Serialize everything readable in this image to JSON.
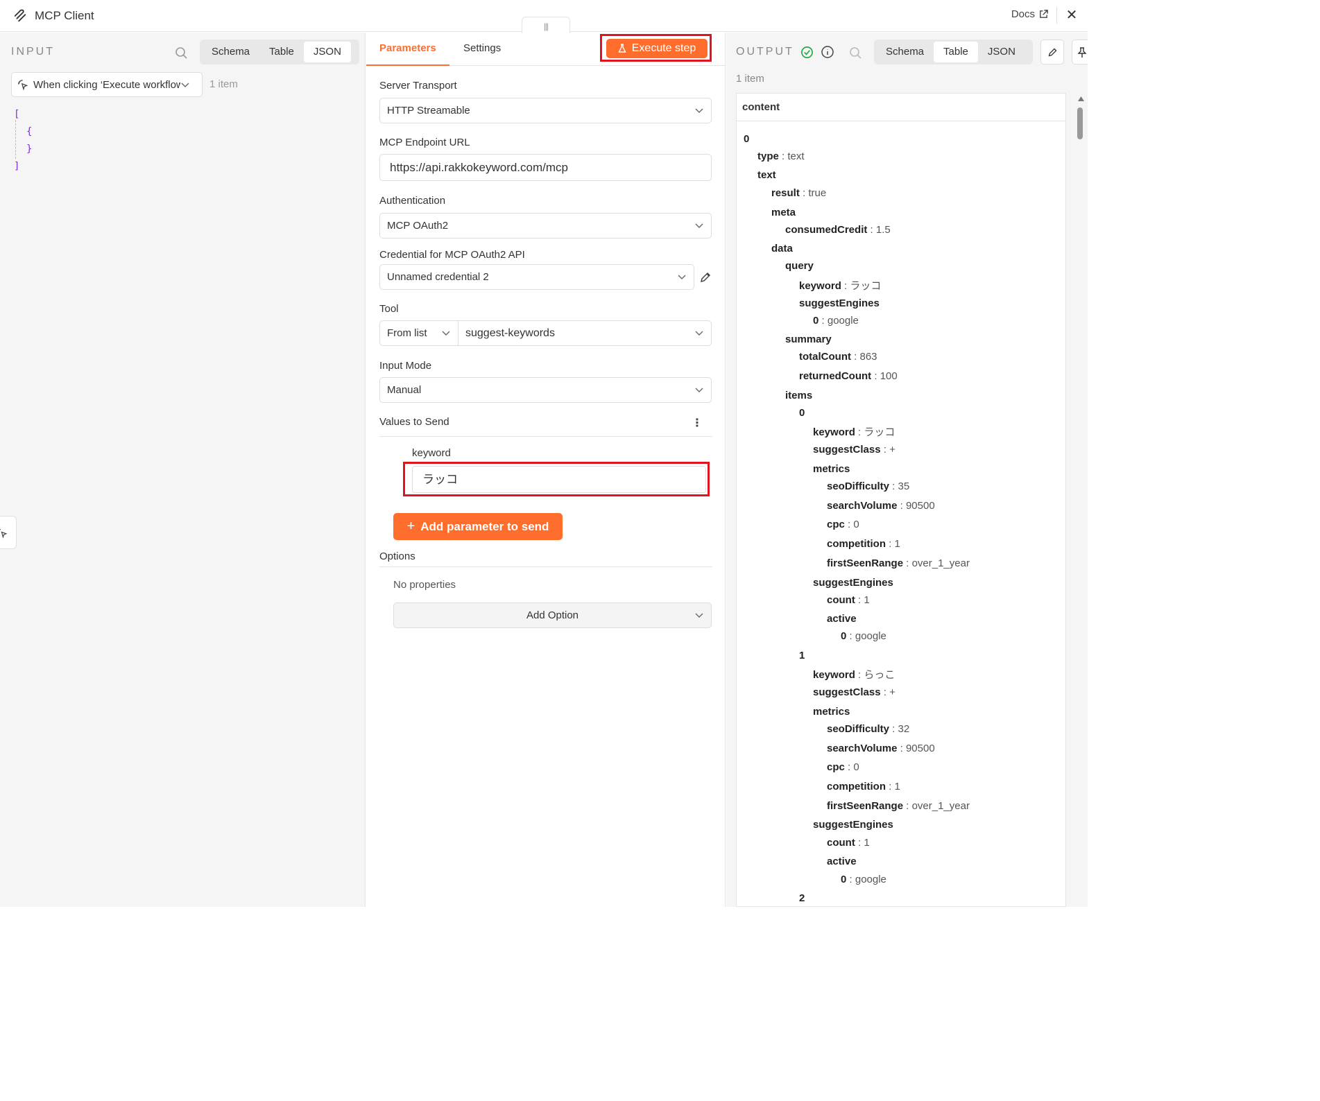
{
  "window": {
    "title": "MCP Client",
    "docs_label": "Docs",
    "close_glyph": "✕"
  },
  "drag_handle_glyph": "|||",
  "input": {
    "label": "INPUT",
    "views": [
      "Schema",
      "Table",
      "JSON"
    ],
    "active_view": "JSON",
    "trigger": "When clicking ‘Execute workflow’",
    "item_count": "1 item",
    "json_lines": [
      "[",
      "{",
      "}",
      "]"
    ]
  },
  "params": {
    "tabs": [
      "Parameters",
      "Settings"
    ],
    "active_tab": "Parameters",
    "execute_label": "Execute step",
    "server_transport": {
      "label": "Server Transport",
      "value": "HTTP Streamable"
    },
    "endpoint": {
      "label": "MCP Endpoint URL",
      "value": "https://api.rakkokeyword.com/mcp"
    },
    "authentication": {
      "label": "Authentication",
      "value": "MCP OAuth2"
    },
    "credential": {
      "label": "Credential for MCP OAuth2 API",
      "value": "Unnamed credential 2"
    },
    "tool": {
      "label": "Tool",
      "mode": "From list",
      "value": "suggest-keywords"
    },
    "input_mode": {
      "label": "Input Mode",
      "value": "Manual"
    },
    "values_to_send": {
      "label": "Values to Send",
      "kebab": "⋮",
      "param_name": "keyword",
      "param_value": "ラッコ"
    },
    "add_param_label": "Add parameter to send",
    "options": {
      "label": "Options",
      "empty": "No properties",
      "add_label": "Add Option"
    }
  },
  "output": {
    "label": "OUTPUT",
    "views": [
      "Schema",
      "Table",
      "JSON"
    ],
    "active_view": "Table",
    "item_count": "1 item",
    "column": "content",
    "rows": [
      {
        "k": "0",
        "lvl": 0
      },
      {
        "k": "type",
        "v": "text",
        "lvl": 1
      },
      {
        "k": "text",
        "lvl": 1
      },
      {
        "k": "result",
        "v": "true",
        "lvl": 2
      },
      {
        "k": "meta",
        "lvl": 2
      },
      {
        "k": "consumedCredit",
        "v": "1.5",
        "lvl": 3
      },
      {
        "k": "data",
        "lvl": 2
      },
      {
        "k": "query",
        "lvl": 3
      },
      {
        "k": "keyword",
        "v": "ラッコ",
        "lvl": 4
      },
      {
        "k": "suggestEngines",
        "lvl": 4
      },
      {
        "k": "0",
        "v": "google",
        "lvl": 5
      },
      {
        "k": "summary",
        "lvl": 3
      },
      {
        "k": "totalCount",
        "v": "863",
        "lvl": 4
      },
      {
        "k": "returnedCount",
        "v": "100",
        "lvl": 4
      },
      {
        "k": "items",
        "lvl": 3
      },
      {
        "k": "0",
        "lvl": 4
      },
      {
        "k": "keyword",
        "v": "ラッコ",
        "lvl": 5
      },
      {
        "k": "suggestClass",
        "v": "+",
        "lvl": 5
      },
      {
        "k": "metrics",
        "lvl": 5
      },
      {
        "k": "seoDifficulty",
        "v": "35",
        "lvl": 6
      },
      {
        "k": "searchVolume",
        "v": "90500",
        "lvl": 6
      },
      {
        "k": "cpc",
        "v": "0",
        "lvl": 6
      },
      {
        "k": "competition",
        "v": "1",
        "lvl": 6
      },
      {
        "k": "firstSeenRange",
        "v": "over_1_year",
        "lvl": 6
      },
      {
        "k": "suggestEngines",
        "lvl": 5
      },
      {
        "k": "count",
        "v": "1",
        "lvl": 6
      },
      {
        "k": "active",
        "lvl": 6
      },
      {
        "k": "0",
        "v": "google",
        "lvl": 7
      },
      {
        "k": "1",
        "lvl": 4
      },
      {
        "k": "keyword",
        "v": "らっこ",
        "lvl": 5
      },
      {
        "k": "suggestClass",
        "v": "+",
        "lvl": 5
      },
      {
        "k": "metrics",
        "lvl": 5
      },
      {
        "k": "seoDifficulty",
        "v": "32",
        "lvl": 6
      },
      {
        "k": "searchVolume",
        "v": "90500",
        "lvl": 6
      },
      {
        "k": "cpc",
        "v": "0",
        "lvl": 6
      },
      {
        "k": "competition",
        "v": "1",
        "lvl": 6
      },
      {
        "k": "firstSeenRange",
        "v": "over_1_year",
        "lvl": 6
      },
      {
        "k": "suggestEngines",
        "lvl": 5
      },
      {
        "k": "count",
        "v": "1",
        "lvl": 6
      },
      {
        "k": "active",
        "lvl": 6
      },
      {
        "k": "0",
        "v": "google",
        "lvl": 7
      },
      {
        "k": "2",
        "lvl": 4
      }
    ]
  },
  "colors": {
    "accent": "#ff6d2d",
    "highlight": "#e0141c",
    "success": "#2aa84a",
    "json_bracket": "#7b2fd6"
  }
}
